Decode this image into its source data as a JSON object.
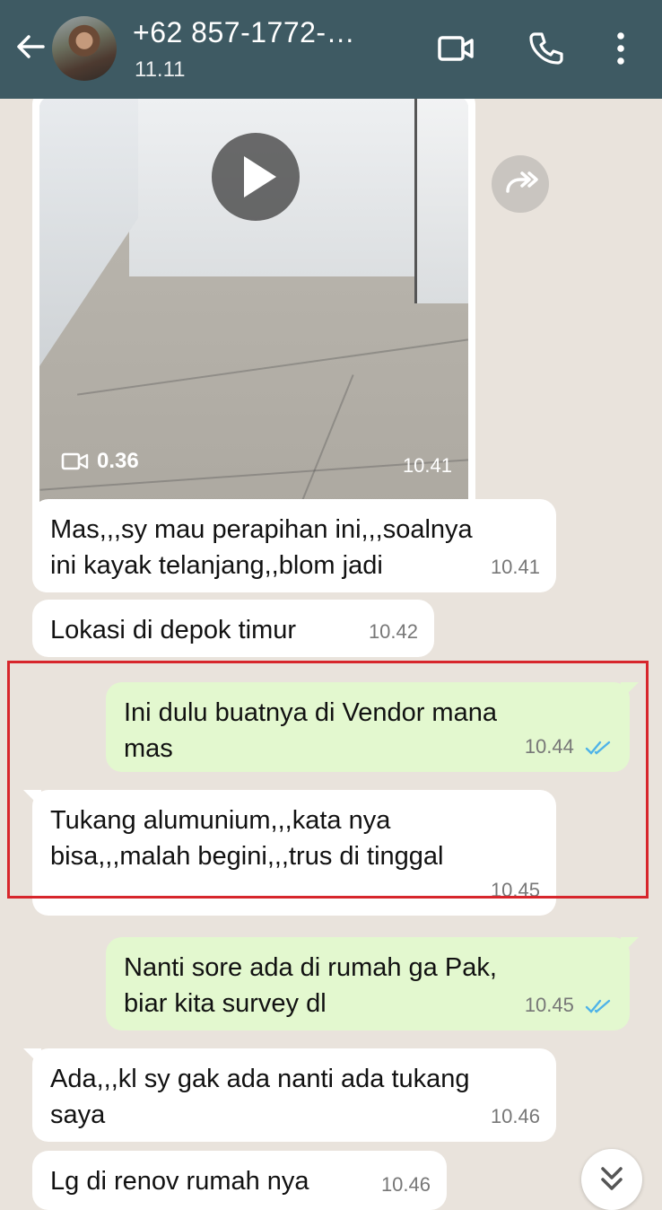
{
  "header": {
    "contact_name": "+62 857-1772-…",
    "status": "11.11"
  },
  "media": {
    "duration": "0.36",
    "time": "10.41"
  },
  "messages": [
    {
      "dir": "in",
      "text_lines": [
        "Mas,,,sy mau perapihan ini,,,soalnya",
        "ini kayak telanjang,,blom jadi"
      ],
      "time": "10.41"
    },
    {
      "dir": "in",
      "text_lines": [
        "Lokasi di depok timur"
      ],
      "time": "10.42"
    },
    {
      "dir": "out",
      "text_lines": [
        "Ini dulu buatnya di Vendor mana",
        "mas"
      ],
      "time": "10.44",
      "read": true
    },
    {
      "dir": "in",
      "text_lines": [
        "Tukang alumunium,,,kata nya",
        "bisa,,,malah begini,,,trus di tinggal"
      ],
      "time": "10.45"
    },
    {
      "dir": "out",
      "text_lines": [
        "Nanti sore ada di rumah ga Pak,",
        "biar kita survey dl"
      ],
      "time": "10.45",
      "read": true
    },
    {
      "dir": "in",
      "text_lines": [
        "Ada,,,kl sy gak ada nanti ada tukang",
        "saya"
      ],
      "time": "10.46"
    },
    {
      "dir": "in",
      "text_lines": [
        "Lg di renov rumah nya"
      ],
      "time": "10.46"
    }
  ],
  "colors": {
    "header": "#3e5a63",
    "chat_bg": "#e9e3dc",
    "outgoing": "#e3f8cf",
    "incoming": "#ffffff",
    "read_ticks": "#4fb3e8",
    "highlight": "#d7262c"
  },
  "icons": {
    "back": "arrow-left-icon",
    "video_call": "video-camera-icon",
    "voice_call": "phone-icon",
    "menu": "more-vertical-icon",
    "play": "play-icon",
    "forward": "forward-icon",
    "scroll": "double-chevron-down-icon"
  }
}
